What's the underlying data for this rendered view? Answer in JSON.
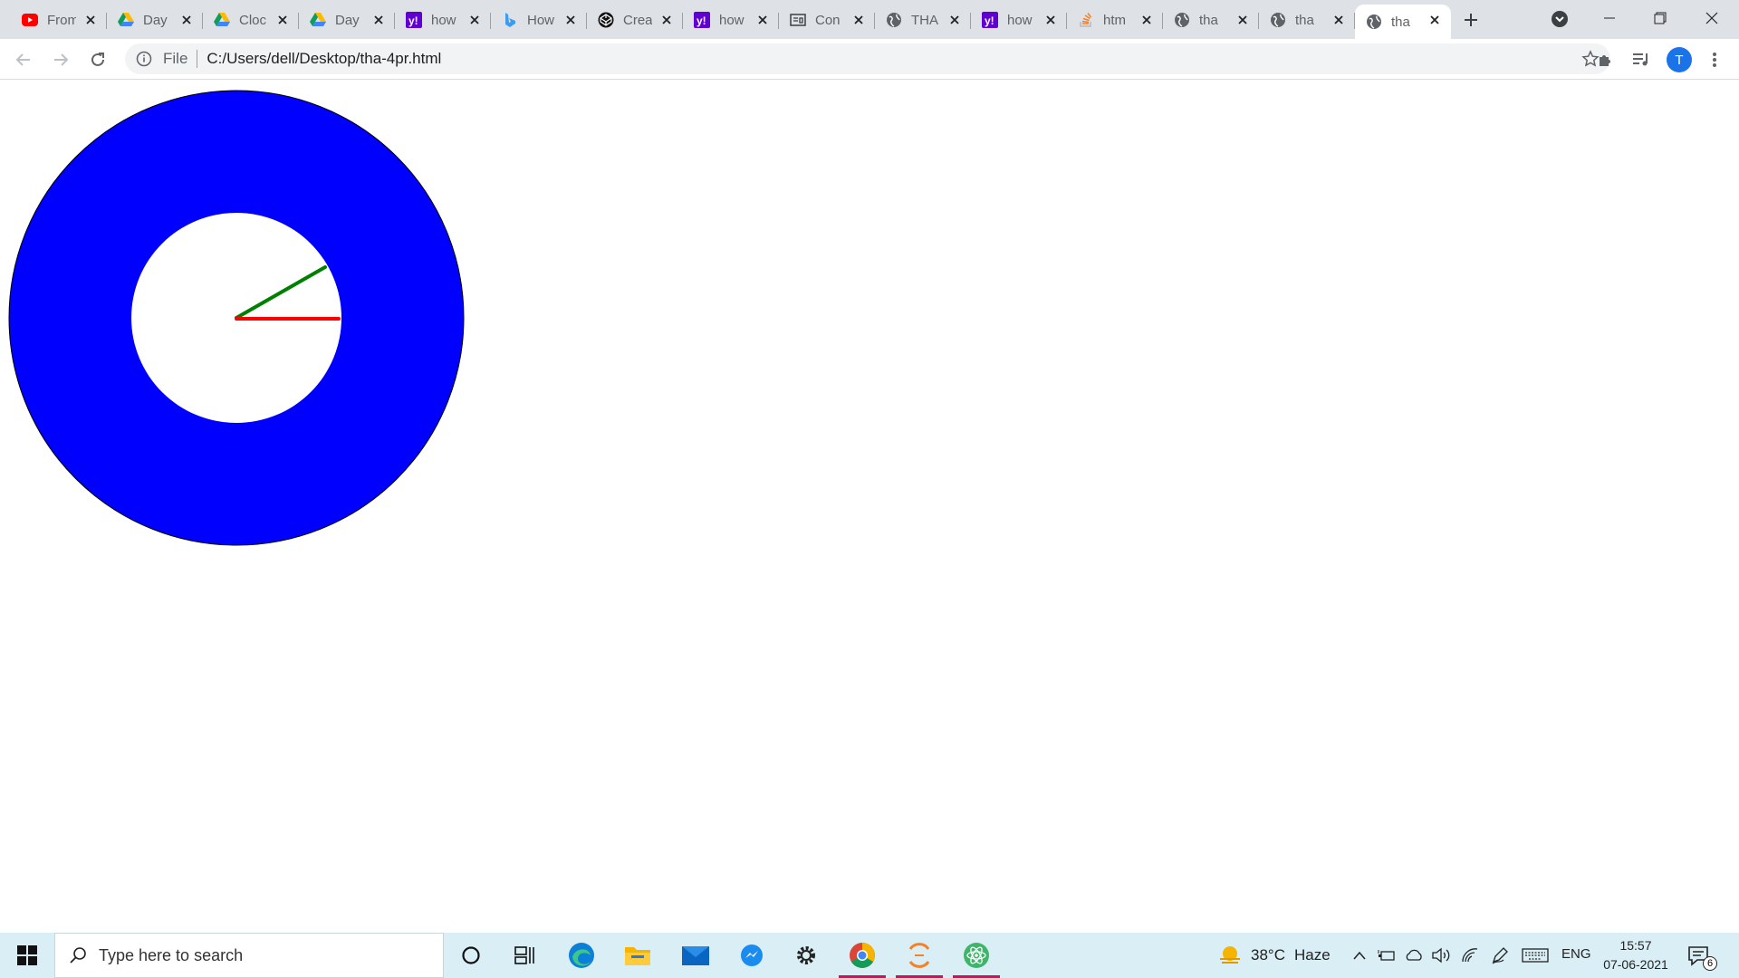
{
  "browser": {
    "tabs": [
      {
        "title": "From",
        "icon": "youtube-icon",
        "active": false
      },
      {
        "title": "Day",
        "icon": "google-drive-icon",
        "active": false
      },
      {
        "title": "Cloc",
        "icon": "google-drive-icon",
        "active": false
      },
      {
        "title": "Day",
        "icon": "google-drive-icon",
        "active": false
      },
      {
        "title": "how",
        "icon": "yahoo-icon",
        "active": false
      },
      {
        "title": "How",
        "icon": "bing-icon",
        "active": false
      },
      {
        "title": "Crea",
        "icon": "codepen-icon",
        "active": false
      },
      {
        "title": "how",
        "icon": "yahoo-icon",
        "active": false
      },
      {
        "title": "Con",
        "icon": "window-icon",
        "active": false
      },
      {
        "title": "THA",
        "icon": "globe-icon",
        "active": false
      },
      {
        "title": "how",
        "icon": "yahoo-icon",
        "active": false
      },
      {
        "title": "htm",
        "icon": "stackoverflow-icon",
        "active": false
      },
      {
        "title": "tha",
        "icon": "globe-icon",
        "active": false
      },
      {
        "title": "tha",
        "icon": "globe-icon",
        "active": false
      },
      {
        "title": "tha",
        "icon": "globe-icon",
        "active": true
      }
    ],
    "address": {
      "scheme_label": "File",
      "url": "C:/Users/dell/Desktop/tha-4pr.html"
    },
    "profile_initial": "T"
  },
  "page": {
    "ring_outer_color": "#0000ff",
    "ring_inner_color": "#ffffff",
    "hand_green_color": "#008000",
    "hand_red_color": "#ff0000"
  },
  "taskbar": {
    "search_placeholder": "Type here to search",
    "weather_temp": "38°C",
    "weather_desc": "Haze",
    "language": "ENG",
    "time": "15:57",
    "date": "07-06-2021",
    "notification_count": "6"
  }
}
